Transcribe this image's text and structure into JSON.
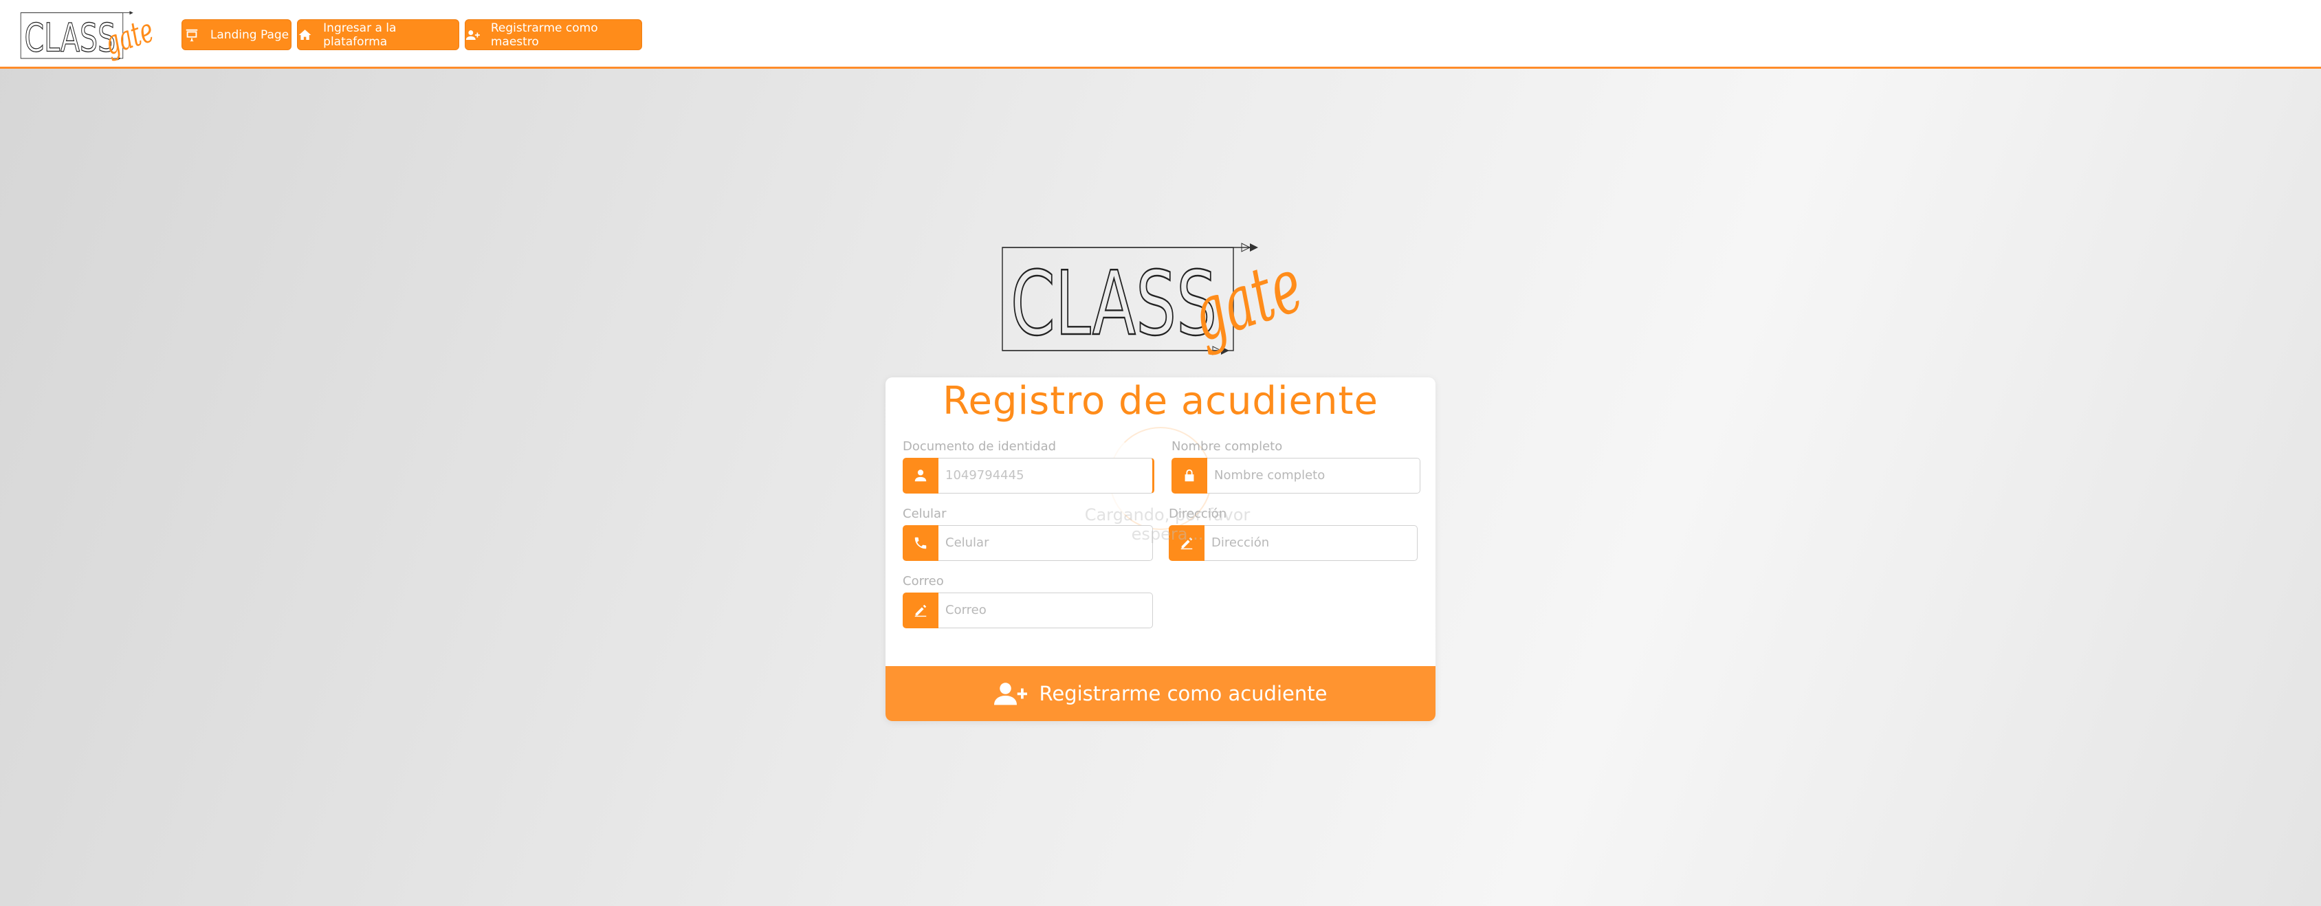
{
  "brand": {
    "word": "CLASS",
    "script": "gate",
    "accent": "#ff8c1a"
  },
  "nav": {
    "landing": {
      "label": "Landing Page",
      "icon": "presentation-icon"
    },
    "login": {
      "label": "Ingresar a la plataforma",
      "icon": "home-icon"
    },
    "teacher": {
      "label": "Registrarme como maestro",
      "icon": "user-plus-icon"
    }
  },
  "form": {
    "title": "Registro de acudiente",
    "loading_text": "Cargando, por favor espera...",
    "fields": {
      "documento": {
        "label": "Documento de identidad",
        "value": "1049794445",
        "icon": "user-icon"
      },
      "nombre": {
        "label": "Nombre completo",
        "placeholder": "Nombre completo",
        "icon": "lock-icon"
      },
      "celular": {
        "label": "Celular",
        "placeholder": "Celular",
        "icon": "phone-icon"
      },
      "direccion": {
        "label": "Dirección",
        "placeholder": "Dirección",
        "icon": "pen-icon"
      },
      "correo": {
        "label": "Correo",
        "placeholder": "Correo",
        "icon": "pen-icon"
      }
    },
    "submit_label": "Registrarme como acudiente"
  }
}
